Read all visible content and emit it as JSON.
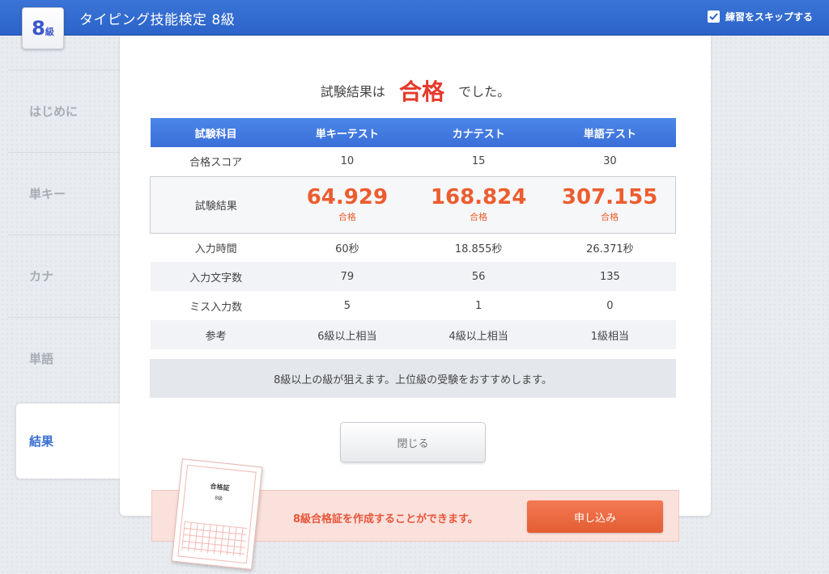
{
  "header": {
    "level_num": "8",
    "level_kyu": "級",
    "title": "タイピング技能検定 8級",
    "skip_label": "練習をスキップする"
  },
  "sidebar": {
    "items": [
      {
        "label": "はじめに"
      },
      {
        "label": "単キー"
      },
      {
        "label": "カナ"
      },
      {
        "label": "単語"
      },
      {
        "label": "結果"
      }
    ]
  },
  "result": {
    "prefix": "試験結果は",
    "status": "合格",
    "suffix": "でした。"
  },
  "table": {
    "headers": [
      "試験科目",
      "単キーテスト",
      "カナテスト",
      "単語テスト"
    ],
    "pass_score": {
      "label": "合格スコア",
      "values": [
        "10",
        "15",
        "30"
      ]
    },
    "result": {
      "label": "試験結果",
      "values": [
        "64.929",
        "168.824",
        "307.155"
      ],
      "status": [
        "合格",
        "合格",
        "合格"
      ]
    },
    "input_time": {
      "label": "入力時間",
      "values": [
        "60秒",
        "18.855秒",
        "26.371秒"
      ]
    },
    "char_count": {
      "label": "入力文字数",
      "values": [
        "79",
        "56",
        "135"
      ]
    },
    "miss_count": {
      "label": "ミス入力数",
      "values": [
        "5",
        "1",
        "0"
      ]
    },
    "reference": {
      "label": "参考",
      "values": [
        "6級以上相当",
        "4級以上相当",
        "1級相当"
      ]
    }
  },
  "message": "8級以上の級が狙えます。上位級の受験をおすすめします。",
  "close_label": "閉じる",
  "certificate": {
    "text": "8級合格証を作成することができます。",
    "apply_label": "申し込み",
    "paper_title": "合格証",
    "paper_level": "8級"
  },
  "colors": {
    "header_blue": "#2b63c9",
    "pass_red": "#e53a2b",
    "score_orange": "#ec5d2f",
    "apply_orange": "#e45d33"
  }
}
